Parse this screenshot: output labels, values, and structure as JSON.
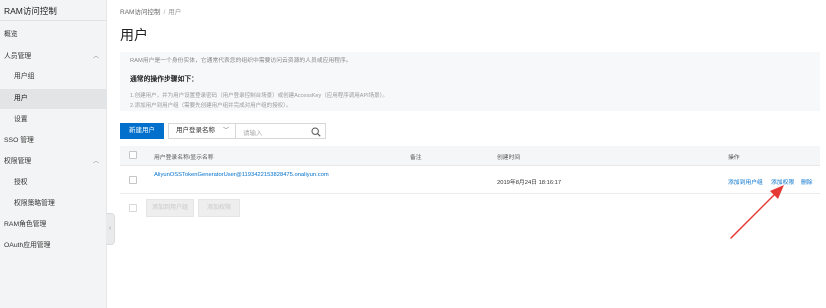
{
  "sidebar": {
    "title": "RAM访问控制",
    "items": [
      {
        "label": "概览"
      },
      {
        "label": "人员管理"
      },
      {
        "label": "用户组"
      },
      {
        "label": "用户"
      },
      {
        "label": "设置"
      },
      {
        "label": "SSO 管理"
      },
      {
        "label": "权限管理"
      },
      {
        "label": "授权"
      },
      {
        "label": "权限策略管理"
      },
      {
        "label": "RAM角色管理"
      },
      {
        "label": "OAuth应用管理"
      }
    ]
  },
  "breadcrumb": {
    "root": "RAM访问控制",
    "separator": "/",
    "current": "用户"
  },
  "page": {
    "title": "用户",
    "notice": {
      "description": "RAM用户是一个身份实体，它通常代表您的组织中需要访问云资源的人员或应用程序。",
      "subtitle": "通常的操作步骤如下：",
      "step1": "1.创建用户，并为用户设置登录密码（用户登录控制台场景）或创建AccessKey（应用程序调用API场景）。",
      "step2": "2.添加用户到用户组（需要先创建用户组并完成对用户组的授权）。"
    }
  },
  "toolbar": {
    "create_label": "新建用户",
    "filter_value": "用户登录名称",
    "search_placeholder": "请输入"
  },
  "table": {
    "headers": {
      "name": "用户登录名称/显示名称",
      "note": "备注",
      "created": "创建时间",
      "actions": "操作"
    },
    "rows": [
      {
        "name": "AliyunOSSTokenGeneratorUser@1193422153828475.onaliyun.com",
        "note": "",
        "created": "2019年8月24日 18:16:17",
        "action_add_group": "添加到用户组",
        "action_add_perm": "添加权限",
        "action_delete": "删除"
      }
    ]
  },
  "footer": {
    "batch_add_group": "添加到用户组",
    "batch_add_perm": "添加权限"
  },
  "colors": {
    "primary": "#0070cc",
    "annotation_arrow": "#e53935"
  }
}
